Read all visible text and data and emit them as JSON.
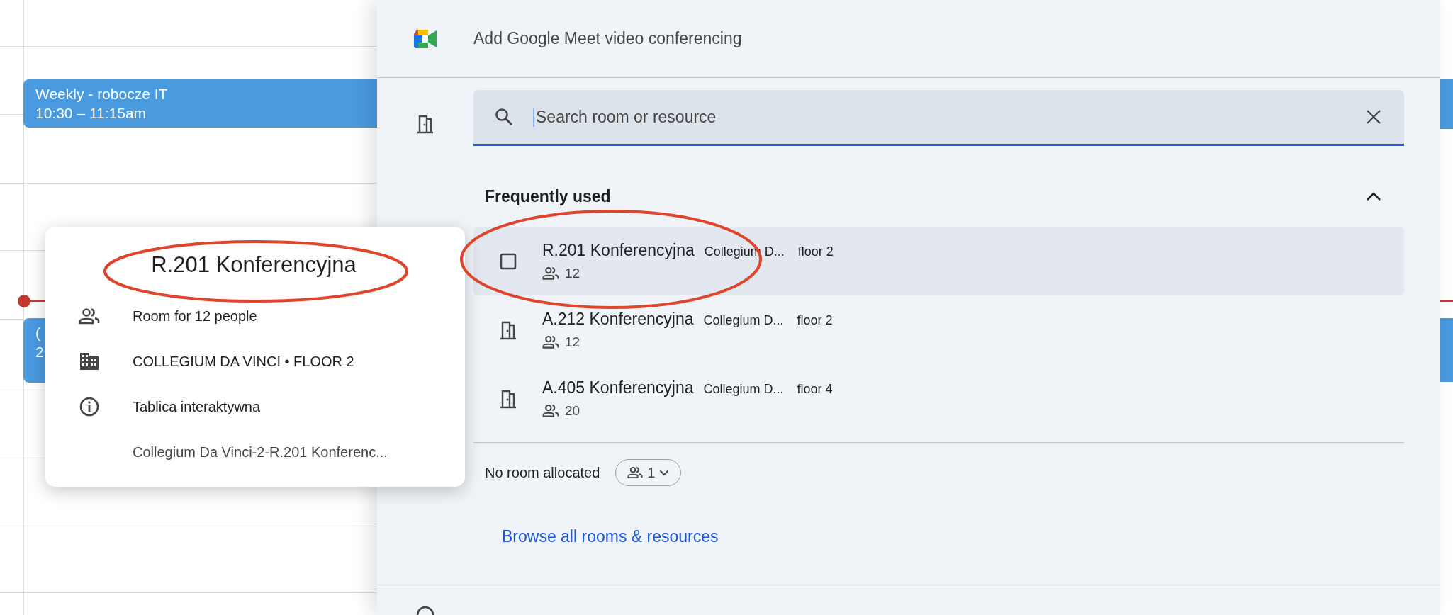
{
  "calendar": {
    "events": [
      {
        "title": "Weekly - robocze IT",
        "time": "10:30 – 11:15am"
      },
      {
        "title": "(",
        "time": "2"
      }
    ]
  },
  "panel": {
    "meet": {
      "label": "Add Google Meet video conferencing"
    },
    "search": {
      "placeholder": "Search room or resource"
    },
    "section": {
      "title": "Frequently used",
      "expanded": true
    },
    "rooms": [
      {
        "kind": "checkbox",
        "checked": false,
        "selected": true,
        "name": "R.201 Konferencyjna",
        "building": "Collegium D...",
        "floor": "floor 2",
        "capacity": "12"
      },
      {
        "kind": "room",
        "selected": false,
        "name": "A.212 Konferencyjna",
        "building": "Collegium D...",
        "floor": "floor 2",
        "capacity": "12"
      },
      {
        "kind": "room",
        "selected": false,
        "name": "A.405 Konferencyjna",
        "building": "Collegium D...",
        "floor": "floor 4",
        "capacity": "20"
      }
    ],
    "no_room": {
      "label": "No room allocated",
      "count": "1"
    },
    "browse_link": "Browse all rooms & resources"
  },
  "popup": {
    "title": "R.201 Konferencyjna",
    "rows": [
      {
        "kind": "people",
        "text": "Room for 12 people"
      },
      {
        "kind": "building",
        "text": "COLLEGIUM DA VINCI • FLOOR 2"
      },
      {
        "kind": "info",
        "text": "Tablica interaktywna"
      },
      {
        "kind": "plain",
        "text": "Collegium Da Vinci-2-R.201 Konferenc..."
      }
    ]
  }
}
